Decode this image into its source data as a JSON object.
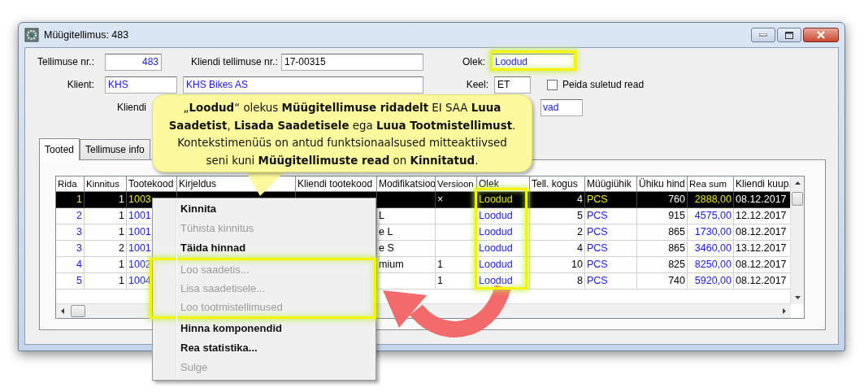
{
  "window": {
    "title": "Müügitellimus: 483"
  },
  "form": {
    "order_no_label": "Tellimuse nr.:",
    "order_no": "483",
    "customer_order_label": "Kliendi tellimuse nr.:",
    "customer_order": "17-00315",
    "status_label": "Olek:",
    "status": "Loodud",
    "client_label": "Klient:",
    "client_code": "KHS",
    "client_name": "KHS Bikes AS",
    "language_label": "Keel:",
    "language": "ET",
    "hide_closed": {
      "label": "Peida suletud read",
      "checked": false
    },
    "row3_label": "Kliendi",
    "row3_value": "vad"
  },
  "tabs": [
    {
      "label": "Tooted",
      "selected": true
    },
    {
      "label": "Tellimuse info",
      "selected": false
    }
  ],
  "table": {
    "columns": [
      {
        "label": "Rida",
        "kind": "key"
      },
      {
        "label": "Kinnitus",
        "kind": "number"
      },
      {
        "label": "Tootekood",
        "kind": "link"
      },
      {
        "label": "Kirjeldus",
        "kind": "text"
      },
      {
        "label": "Kliendi tootekood",
        "kind": "text"
      },
      {
        "label": "Modifikatsioo",
        "kind": "text"
      },
      {
        "label": "Versioon",
        "kind": "text"
      },
      {
        "label": "Olek",
        "kind": "link"
      },
      {
        "label": "Tell. kogus",
        "kind": "number"
      },
      {
        "label": "Müügiühik",
        "kind": "link"
      },
      {
        "label": "Ühiku hind",
        "kind": "number"
      },
      {
        "label": "Rea sum",
        "kind": "amount"
      },
      {
        "label": "Kliendi kuup.",
        "kind": "text"
      }
    ],
    "rows": [
      {
        "selected": true,
        "cells": [
          "1",
          "1",
          "1003",
          null,
          null,
          null,
          "×",
          "Loodud",
          "4",
          "PCS",
          "760",
          "2888,00",
          "08.12.2017"
        ]
      },
      {
        "selected": false,
        "cells": [
          "2",
          "1",
          "1001",
          null,
          null,
          "L",
          null,
          "Loodud",
          "5",
          "PCS",
          "915",
          "4575,00",
          "12.12.2017"
        ]
      },
      {
        "selected": false,
        "cells": [
          "3",
          "1",
          "1001",
          null,
          null,
          "e L",
          null,
          "Loodud",
          "2",
          "PCS",
          "865",
          "1730,00",
          "08.12.2017"
        ]
      },
      {
        "selected": false,
        "cells": [
          "3",
          "2",
          "1001",
          null,
          null,
          "e S",
          null,
          "Loodud",
          "4",
          "PCS",
          "865",
          "3460,00",
          "13.12.2017"
        ]
      },
      {
        "selected": false,
        "cells": [
          "4",
          "1",
          "1002",
          null,
          null,
          "mium",
          "1",
          "Loodud",
          "10",
          "PCS",
          "825",
          "8250,00",
          "08.12.2017"
        ]
      },
      {
        "selected": false,
        "cells": [
          "5",
          "1",
          "1004",
          null,
          null,
          null,
          "1",
          "Loodud",
          "8",
          "PCS",
          "740",
          "5920,00",
          "08.12.2017"
        ]
      }
    ]
  },
  "context_menu": [
    {
      "label": "Kinnita",
      "disabled": false,
      "highlighted": false
    },
    {
      "label": "Tühista kinnitus",
      "disabled": true,
      "highlighted": false
    },
    {
      "label": "Täida hinnad",
      "disabled": false,
      "highlighted": false
    },
    {
      "label": "Loo saadetis...",
      "disabled": true,
      "highlighted": true
    },
    {
      "label": "Lisa saadetisele...",
      "disabled": true,
      "highlighted": true
    },
    {
      "label": "Loo tootmistellimused",
      "disabled": true,
      "highlighted": true
    },
    {
      "label": "Hinna komponendid",
      "disabled": false,
      "highlighted": false
    },
    {
      "label": "Rea statistika...",
      "disabled": false,
      "highlighted": false
    },
    {
      "label": "Sulge",
      "disabled": true,
      "highlighted": false
    }
  ],
  "callout": {
    "text": "„**Loodud**“ olekus **Müügitellimuse ridadelt** EI SAA  **Luua Saadetist**, **Lisada Saadetisele** ega **Luua Tootmistellimust**. Kontekstimenüüs on antud funktsionaalsused mitteaktiivsed seni kuni **Müügitellimuste read** on **Kinnitatud**."
  }
}
